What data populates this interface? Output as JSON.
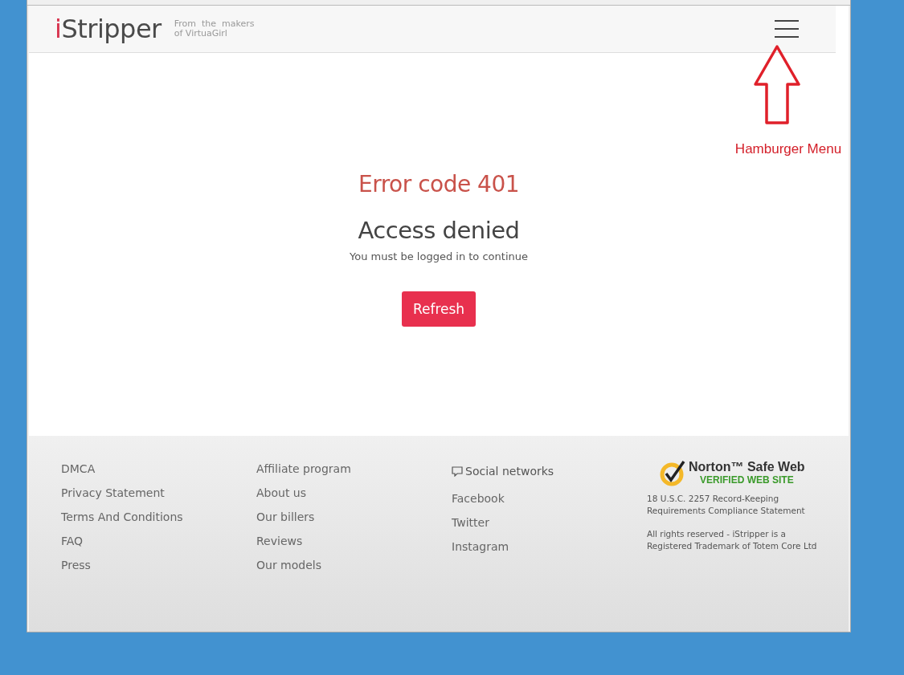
{
  "header": {
    "logo": "iStripper",
    "tagline": [
      "From  the  makers",
      "of VirtuaGirl"
    ]
  },
  "annotation": {
    "label": "Hamburger Menu"
  },
  "error": {
    "code": "Error code 401",
    "title": "Access denied",
    "message": "You must be logged in to continue",
    "button": "Refresh"
  },
  "footer": {
    "columns": [
      {
        "links": [
          "DMCA",
          "Privacy Statement",
          "Terms And Conditions",
          "FAQ",
          "Press"
        ]
      },
      {
        "links": [
          "Affiliate program",
          "About us",
          "Our billers",
          "Reviews",
          "Our models"
        ]
      },
      {
        "heading": "Social networks",
        "links": [
          "Facebook",
          "Twitter",
          "Instagram"
        ]
      }
    ],
    "badge": {
      "name": "Norton™ Safe Web",
      "subtitle": "VERIFIED WEB SITE"
    },
    "notes": [
      "18 U.S.C. 2257 Record-Keeping Requirements Compliance Statement",
      "All rights reserved - iStripper is a Registered Trademark of Totem Core Ltd"
    ]
  }
}
